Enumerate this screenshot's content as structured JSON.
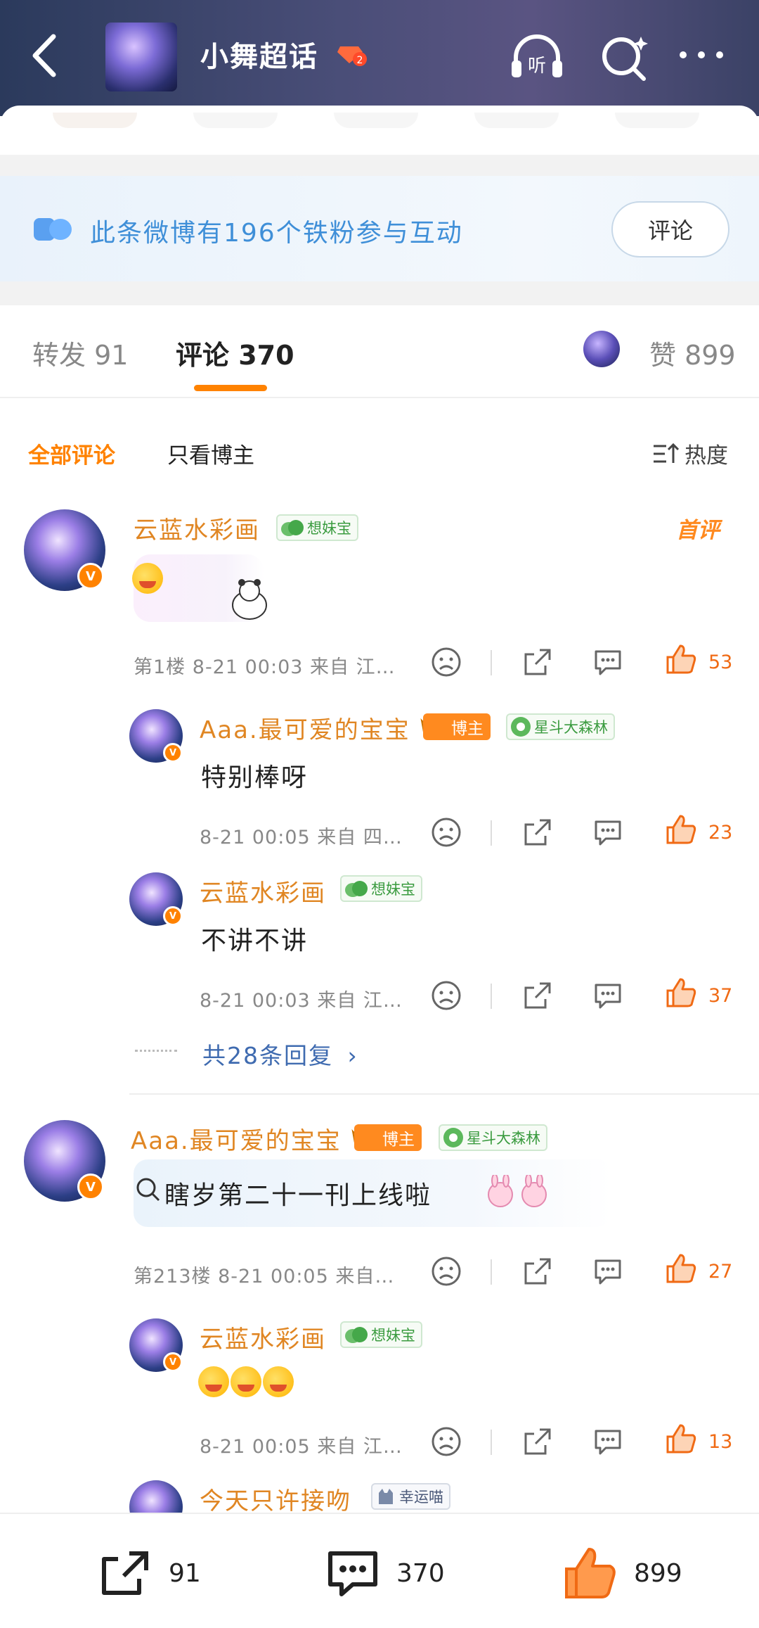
{
  "header": {
    "title": "小舞超话",
    "level_badge": "2",
    "listen_label": "听"
  },
  "fans_banner": {
    "text": "此条微博有196个铁粉参与互动",
    "button": "评论"
  },
  "tabs": {
    "repost": "转发 91",
    "comment": "评论 370",
    "like": "赞 899"
  },
  "filters": {
    "all": "全部评论",
    "op_only": "只看博主",
    "sort": "热度"
  },
  "comments": [
    {
      "user": "云蓝水彩画",
      "tag": "想妹宝",
      "first_tag": "首评",
      "meta": "第1楼 8-21 00:03 来自 江…",
      "likes": "53",
      "replies": [
        {
          "user": "Aaa.最可爱的宝宝",
          "badge": "博主",
          "tag": "星斗大森林",
          "text": "特别棒呀",
          "meta": "8-21 00:05 来自 四…",
          "likes": "23"
        },
        {
          "user": "云蓝水彩画",
          "tag": "想妹宝",
          "text": "不讲不讲",
          "meta": "8-21 00:03 来自 江…",
          "likes": "37"
        }
      ],
      "more_replies": "共28条回复"
    },
    {
      "user": "Aaa.最可爱的宝宝",
      "badge": "博主",
      "tag": "星斗大森林",
      "text": "瞎岁第二十一刊上线啦",
      "meta": "第213楼 8-21 00:05 来自…",
      "likes": "27",
      "replies": [
        {
          "user": "云蓝水彩画",
          "tag": "想妹宝",
          "meta": "8-21 00:05 来自 江…",
          "likes": "13"
        },
        {
          "user": "今天只许接吻",
          "tag": "幸运喵"
        }
      ]
    }
  ],
  "bottom_bar": {
    "repost": "91",
    "comment": "370",
    "like": "899"
  },
  "colors": {
    "accent": "#ff8200",
    "username": "#e08623",
    "link": "#3f6bb0",
    "fans_text": "#3f8fd8"
  }
}
